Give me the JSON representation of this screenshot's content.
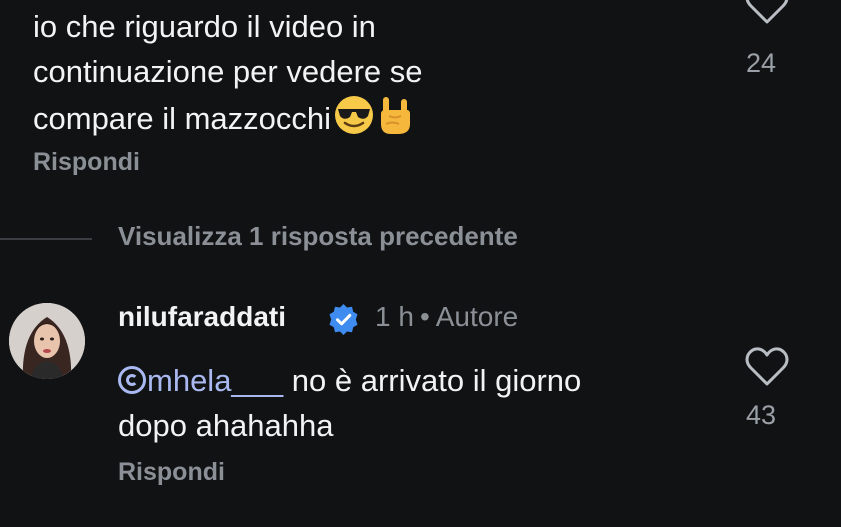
{
  "comment1": {
    "text_line1": "io che riguardo il video in",
    "text_line2": "continuazione per vedere se",
    "text_line3": "compare il mazzocchi",
    "emojis": [
      "sunglasses-emoji",
      "rock-on-hand-emoji"
    ],
    "like_count": "24",
    "reply_label": "Rispondi"
  },
  "view_replies_label": "Visualizza 1 risposta precedente",
  "comment2": {
    "username": "nilufaraddati",
    "verified": true,
    "time": "1 h",
    "separator": "•",
    "author_badge": "Autore",
    "mention": "mhela___",
    "text_rest_line1": " no è arrivato il giorno",
    "text_line2": "dopo ahahahha",
    "like_count": "43",
    "reply_label": "Rispondi"
  },
  "colors": {
    "background": "#101214",
    "text": "#f3f3f3",
    "muted": "#8b9096",
    "mention": "#a9b8ef",
    "verified": "#3f8cf0"
  }
}
